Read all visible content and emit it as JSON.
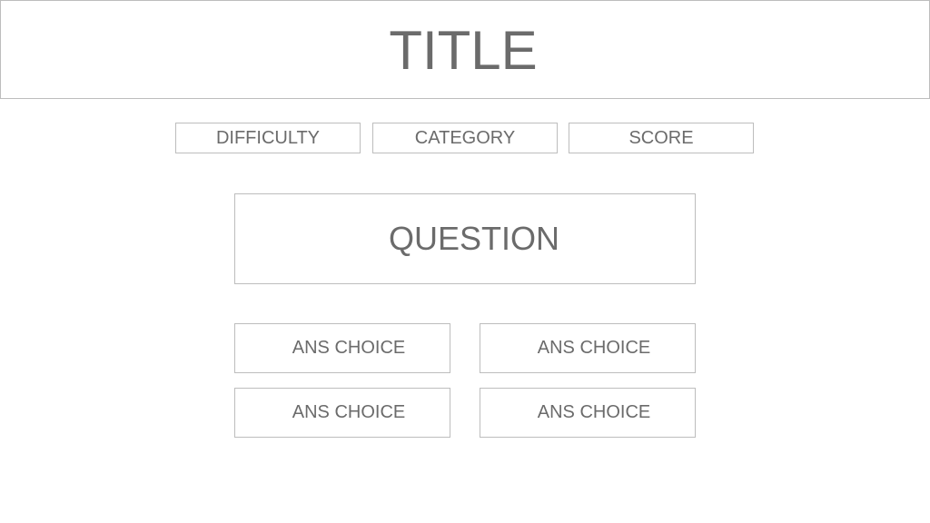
{
  "header": {
    "title": "TITLE"
  },
  "info_bar": {
    "difficulty_label": "DIFFICULTY",
    "category_label": "CATEGORY",
    "score_label": "SCORE"
  },
  "question": {
    "text": "QUESTION"
  },
  "answers": [
    {
      "label": "ANS CHOICE"
    },
    {
      "label": "ANS CHOICE"
    },
    {
      "label": "ANS CHOICE"
    },
    {
      "label": "ANS CHOICE"
    }
  ],
  "colors": {
    "text": "#6b6b6b",
    "border": "#bdbdbd",
    "background": "#ffffff"
  }
}
